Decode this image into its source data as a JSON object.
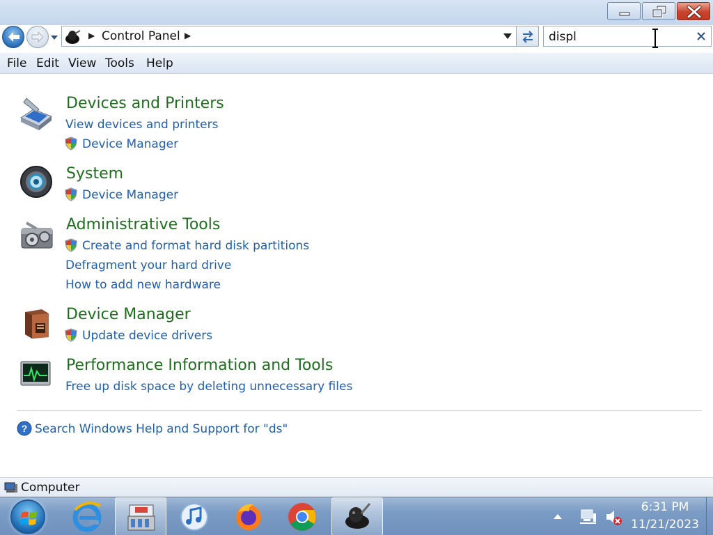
{
  "window": {
    "address": {
      "crumb": "Control Panel"
    },
    "search": {
      "value": "displ"
    }
  },
  "menu": [
    "File",
    "Edit",
    "View",
    "Tools",
    "Help"
  ],
  "categories": [
    {
      "title": "Devices and Printers",
      "icon": "scanner-icon",
      "tasks": [
        {
          "label": "View devices and printers",
          "shield": false
        },
        {
          "label": "Device Manager",
          "shield": true
        }
      ]
    },
    {
      "title": "System",
      "icon": "system-icon",
      "tasks": [
        {
          "label": "Device Manager",
          "shield": true
        }
      ]
    },
    {
      "title": "Administrative Tools",
      "icon": "admin-tools-icon",
      "tasks": [
        {
          "label": "Create and format hard disk partitions",
          "shield": true
        },
        {
          "label": "Defragment your hard drive",
          "shield": false
        },
        {
          "label": "How to add new hardware",
          "shield": false
        }
      ]
    },
    {
      "title": "Device Manager",
      "icon": "device-manager-icon",
      "tasks": [
        {
          "label": "Update device drivers",
          "shield": true
        }
      ]
    },
    {
      "title": "Performance Information and Tools",
      "icon": "performance-icon",
      "tasks": [
        {
          "label": "Free up disk space by deleting unnecessary files",
          "shield": false
        }
      ]
    }
  ],
  "help_link": "Search Windows Help and Support for \"ds\"",
  "status": {
    "text": "Computer"
  },
  "taskbar": {
    "apps": [
      "control-panel-app",
      "internet-explorer",
      "itunes",
      "firefox",
      "chrome",
      "gimp"
    ],
    "clock": {
      "time": "6:31 PM",
      "date": "11/21/2023"
    }
  },
  "colors": {
    "category_title": "#1e6e1e",
    "link": "#1f5fb0"
  }
}
